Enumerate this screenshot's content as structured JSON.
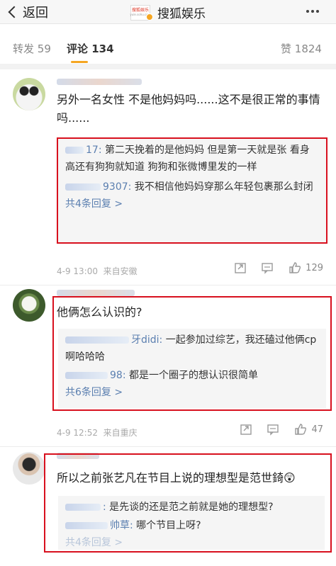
{
  "header": {
    "back_label": "返回",
    "brand_logo_text": "搜狐娱乐",
    "brand_logo_sub": "yule.sohu.com",
    "title": "搜狐娱乐"
  },
  "tabs": {
    "repost_label": "转发",
    "repost_count": "59",
    "comment_label": "评论",
    "comment_count": "134",
    "like_label": "赞",
    "like_count": "1824"
  },
  "comments": [
    {
      "text": "另外一名女性 不是他妈妈吗......这不是很正常的事情吗......",
      "replies": [
        {
          "name": "17:",
          "text": " 第二天挽着的是他妈妈 但是第一天就是张 看身高还有狗狗就知道 狗狗和张微博里发的一样"
        },
        {
          "name": "9307:",
          "text": " 我不相信他妈妈穿那么年轻包裹那么封闭"
        }
      ],
      "more": "共4条回复 >",
      "time": "4-9 13:00",
      "source": "来自安徽",
      "likes": "129"
    },
    {
      "text": "他俩怎么认识的?",
      "replies": [
        {
          "name": "牙didi:",
          "text": " 一起参加过综艺，我还磕过他俩cp啊哈哈哈"
        },
        {
          "name": "98:",
          "text": " 都是一个圈子的想认识很简单"
        }
      ],
      "more": "共6条回复 >",
      "time": "4-9 12:52",
      "source": "来自重庆",
      "likes": "47"
    },
    {
      "text": "所以之前张艺凡在节目上说的理想型是范世錡😲",
      "replies": [
        {
          "name": ":",
          "text": " 是先谈的还是范之前就是她的理想型?"
        },
        {
          "name": "帅草:",
          "text": " 哪个节目上呀?"
        }
      ],
      "more": "共4条回复 >"
    }
  ],
  "colors": {
    "highlight_border": "#d8101e",
    "link": "#5b7fb0",
    "accent": "#f5a623"
  },
  "icons": [
    "chevron-left-icon",
    "more-dots-icon",
    "repost-icon",
    "comment-icon",
    "like-icon",
    "verified-badge-icon"
  ]
}
